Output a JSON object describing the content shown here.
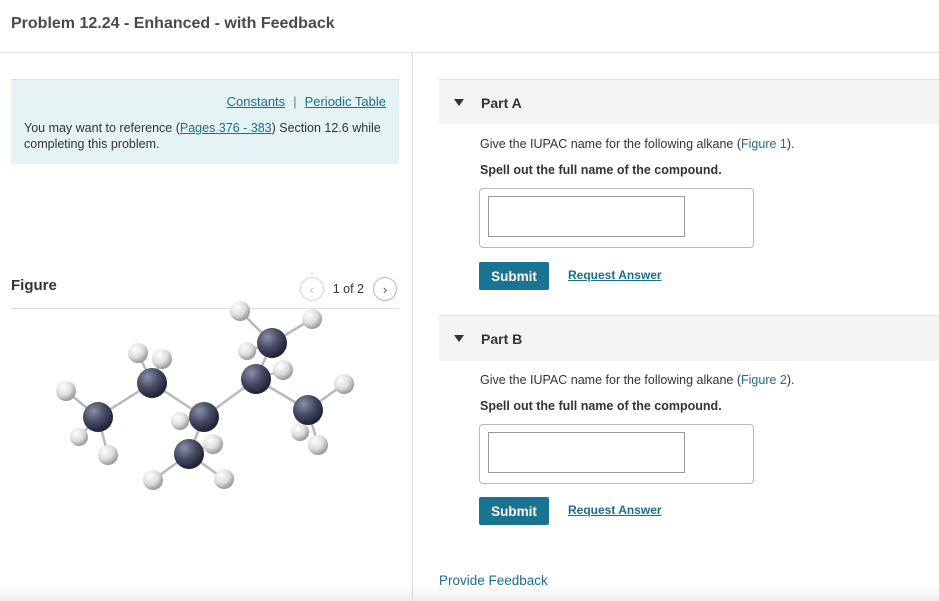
{
  "header": {
    "title": "Problem 12.24 - Enhanced - with Feedback"
  },
  "info": {
    "constants_label": "Constants",
    "separator": "|",
    "periodic_table_label": "Periodic Table",
    "text_before": "You may want to reference (",
    "pages_link": "Pages 376 - 383",
    "text_after": ") Section 12.6 while completing this problem."
  },
  "figure": {
    "title": "Figure",
    "prev_icon": "‹",
    "next_icon": "›",
    "pager_text": "1 of 2"
  },
  "parts": [
    {
      "label": "Part A",
      "question_before": "Give the IUPAC name for the following alkane (",
      "figure_link": "Figure 1",
      "question_after": ").",
      "instruction": "Spell out the full name of the compound.",
      "input_value": "",
      "submit_label": "Submit",
      "request_label": "Request Answer"
    },
    {
      "label": "Part B",
      "question_before": "Give the IUPAC name for the following alkane (",
      "figure_link": "Figure 2",
      "question_after": ").",
      "instruction": "Spell out the full name of the compound.",
      "input_value": "",
      "submit_label": "Submit",
      "request_label": "Request Answer"
    }
  ],
  "feedback_label": "Provide Feedback",
  "colors": {
    "accent": "#1a7391",
    "link": "#1a6f8c",
    "info_bg": "#e6f3f5",
    "carbon": "#3e4257",
    "hydrogen": "#e4e4e4"
  }
}
